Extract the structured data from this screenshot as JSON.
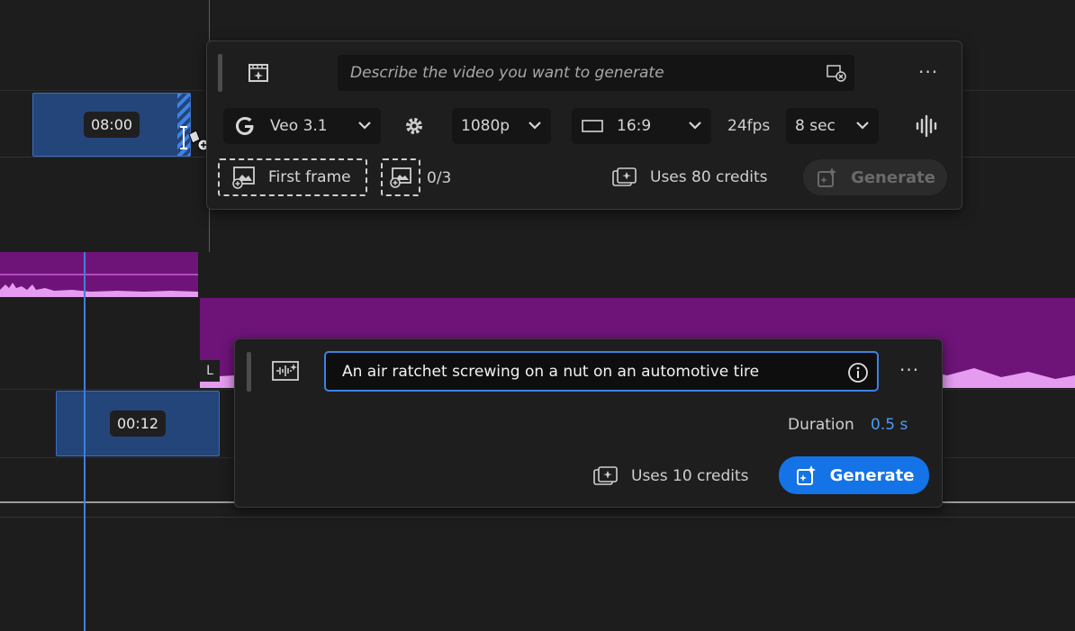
{
  "timeline": {
    "clip_top_time": "08:00",
    "clip_bottom_time": "00:12",
    "track_label": "L"
  },
  "video_panel": {
    "prompt_placeholder": "Describe the video you want to generate",
    "model_label": "Veo 3.1",
    "resolution_label": "1080p",
    "aspect_label": "16:9",
    "fps_label": "24fps",
    "duration_label": "8 sec",
    "first_frame_label": "First frame",
    "reference_count": "0/3",
    "credits_label": "Uses 80 credits",
    "generate_label": "Generate",
    "more_label": "···"
  },
  "sfx_panel": {
    "prompt_value": "An air ratchet screwing on a nut on an automotive tire",
    "duration_label": "Duration",
    "duration_value": "0.5 s",
    "credits_label": "Uses 10 credits",
    "generate_label": "Generate",
    "more_label": "···"
  },
  "colors": {
    "accent": "#1473e6",
    "audio_clip": "#6e1479",
    "video_clip": "#24457a",
    "panel_bg": "#1e1e1e"
  },
  "icons": {
    "video_generate": "video-sparkle-icon",
    "sound_generate": "waveform-sparkle-icon",
    "model_brand": "google-g-icon",
    "settings": "gear-icon",
    "audio_toggle": "audio-waveform-icon",
    "image_attach": "image-add-icon",
    "credits": "credits-icon",
    "info": "info-icon"
  }
}
